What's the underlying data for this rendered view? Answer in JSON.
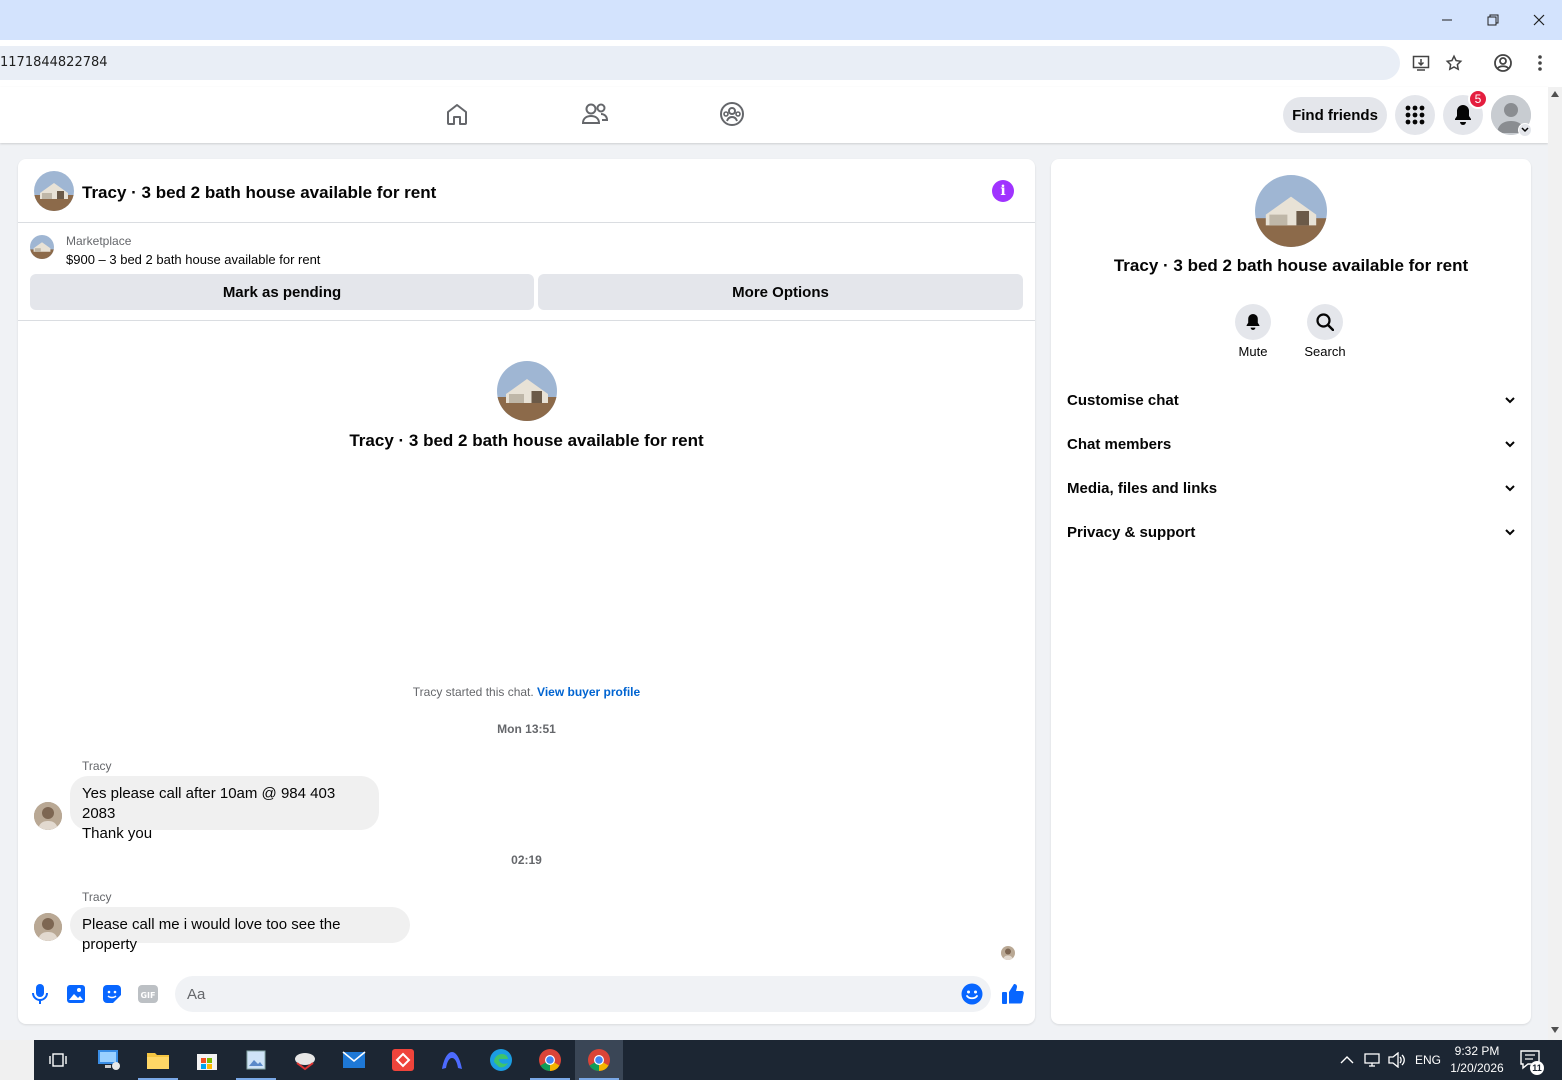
{
  "browser": {
    "url_fragment": "1171844822784"
  },
  "header": {
    "find_friends_label": "Find friends",
    "notification_count": "5"
  },
  "chat": {
    "title": "Tracy · 3 bed 2 bath house available for rent",
    "marketplace_label": "Marketplace",
    "listing_title": "$900 – 3 bed 2 bath house available for rent",
    "mark_pending_label": "Mark as pending",
    "more_options_label": "More Options",
    "center_title": "Tracy · 3 bed 2 bath house available for rent",
    "started_text": "Tracy started this chat. ",
    "view_buyer_profile": "View buyer profile",
    "messages": [
      {
        "timestamp": "Mon 13:51",
        "sender": "Tracy",
        "text": "Yes please call after 10am @ 984 403 2083\n Thank you"
      },
      {
        "timestamp": "02:19",
        "sender": "Tracy",
        "text": "Please call me i would love too see the property"
      }
    ],
    "composer_placeholder": "Aa"
  },
  "right_panel": {
    "title": "Tracy · 3 bed 2 bath house available for rent",
    "actions": [
      {
        "label": "Mute",
        "icon": "bell-icon"
      },
      {
        "label": "Search",
        "icon": "search-icon"
      }
    ],
    "sections": [
      {
        "label": "Customise chat"
      },
      {
        "label": "Chat members"
      },
      {
        "label": "Media, files and links"
      },
      {
        "label": "Privacy & support"
      }
    ]
  },
  "taskbar": {
    "time": "9:32 PM",
    "date": "1/20/2026",
    "language": "ENG",
    "notification_count": "11"
  },
  "colors": {
    "accent_blue": "#0866ff",
    "info_purple": "#a033ff",
    "badge_red": "#e41e3f"
  }
}
